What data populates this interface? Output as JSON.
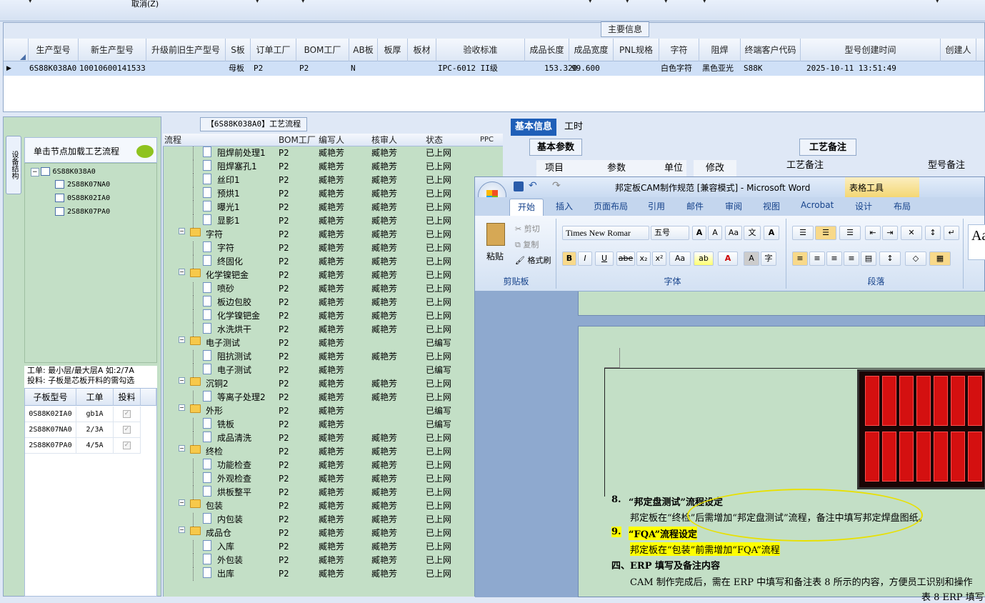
{
  "toolbar": {
    "cancel_label": "取消(Z)"
  },
  "main_info": {
    "title": "主要信息",
    "columns": [
      "生产型号",
      "新生产型号",
      "升级前旧生产型号",
      "S板",
      "订单工厂",
      "BOM工厂",
      "AB板",
      "板厚",
      "板材",
      "验收标准",
      "成品长度",
      "成品宽度",
      "PNL规格",
      "字符",
      "阻焊",
      "终端客户代码",
      "型号创建时间",
      "创建人"
    ],
    "row": {
      "model": "6S88K038A0",
      "new_model": "10010600141533",
      "s_board": "母板",
      "order_factory": "P2",
      "bom_factory": "P2",
      "ab_board": "N",
      "standard": "IPC-6012 II级",
      "length": "153.320",
      "width": "99.600",
      "char": "白色字符",
      "solder": "黑色亚光",
      "customer": "S88K",
      "created": "2025-10-11 13:51:49"
    }
  },
  "left_panel": {
    "side_tab": "设备结构",
    "load_title": "单击节点加载工艺流程",
    "tree": {
      "root": "6S88K038A0",
      "children": [
        "2S88K07NA0",
        "0S88K02IA0",
        "2S88K07PA0"
      ]
    },
    "note1": "工单: 最小层/最大层A 如:2/7A",
    "note2": "投料: 子板是芯板开料的需勾选",
    "sub_grid": {
      "headers": [
        "子板型号",
        "工单",
        "投料"
      ],
      "rows": [
        {
          "model": "0S88K02IA0",
          "order": "gb1A"
        },
        {
          "model": "2S88K07NA0",
          "order": "2/3A"
        },
        {
          "model": "2S88K07PA0",
          "order": "4/5A"
        }
      ]
    }
  },
  "process": {
    "title": "【6S88K038A0】工艺流程",
    "headers": [
      "流程",
      "BOM工厂",
      "编写人",
      "核审人",
      "状态",
      "PPC"
    ],
    "rows": [
      {
        "name": "阻焊前处理1",
        "bom": "P2",
        "writer": "臧艳芳",
        "auditor": "臧艳芳",
        "status": "已上网",
        "level": 2
      },
      {
        "name": "阻焊塞孔1",
        "bom": "P2",
        "writer": "臧艳芳",
        "auditor": "臧艳芳",
        "status": "已上网",
        "level": 2
      },
      {
        "name": "丝印1",
        "bom": "P2",
        "writer": "臧艳芳",
        "auditor": "臧艳芳",
        "status": "已上网",
        "level": 2
      },
      {
        "name": "预烘1",
        "bom": "P2",
        "writer": "臧艳芳",
        "auditor": "臧艳芳",
        "status": "已上网",
        "level": 2
      },
      {
        "name": "曝光1",
        "bom": "P2",
        "writer": "臧艳芳",
        "auditor": "臧艳芳",
        "status": "已上网",
        "level": 2
      },
      {
        "name": "显影1",
        "bom": "P2",
        "writer": "臧艳芳",
        "auditor": "臧艳芳",
        "status": "已上网",
        "level": 2
      },
      {
        "name": "字符",
        "bom": "P2",
        "writer": "臧艳芳",
        "auditor": "臧艳芳",
        "status": "已上网",
        "level": 1
      },
      {
        "name": "字符",
        "bom": "P2",
        "writer": "臧艳芳",
        "auditor": "臧艳芳",
        "status": "已上网",
        "level": 2
      },
      {
        "name": "终固化",
        "bom": "P2",
        "writer": "臧艳芳",
        "auditor": "臧艳芳",
        "status": "已上网",
        "level": 2
      },
      {
        "name": "化学镍钯金",
        "bom": "P2",
        "writer": "臧艳芳",
        "auditor": "臧艳芳",
        "status": "已上网",
        "level": 1
      },
      {
        "name": "喷砂",
        "bom": "P2",
        "writer": "臧艳芳",
        "auditor": "臧艳芳",
        "status": "已上网",
        "level": 2
      },
      {
        "name": "板边包胶",
        "bom": "P2",
        "writer": "臧艳芳",
        "auditor": "臧艳芳",
        "status": "已上网",
        "level": 2
      },
      {
        "name": "化学镍钯金",
        "bom": "P2",
        "writer": "臧艳芳",
        "auditor": "臧艳芳",
        "status": "已上网",
        "level": 2
      },
      {
        "name": "水洗烘干",
        "bom": "P2",
        "writer": "臧艳芳",
        "auditor": "臧艳芳",
        "status": "已上网",
        "level": 2
      },
      {
        "name": "电子测试",
        "bom": "P2",
        "writer": "臧艳芳",
        "auditor": "",
        "status": "已编写",
        "level": 1
      },
      {
        "name": "阻抗测试",
        "bom": "P2",
        "writer": "臧艳芳",
        "auditor": "臧艳芳",
        "status": "已上网",
        "level": 2
      },
      {
        "name": "电子测试",
        "bom": "P2",
        "writer": "臧艳芳",
        "auditor": "",
        "status": "已编写",
        "level": 2
      },
      {
        "name": "沉铜2",
        "bom": "P2",
        "writer": "臧艳芳",
        "auditor": "臧艳芳",
        "status": "已上网",
        "level": 1
      },
      {
        "name": "等离子处理2",
        "bom": "P2",
        "writer": "臧艳芳",
        "auditor": "臧艳芳",
        "status": "已上网",
        "level": 2
      },
      {
        "name": "外形",
        "bom": "P2",
        "writer": "臧艳芳",
        "auditor": "",
        "status": "已编写",
        "level": 1
      },
      {
        "name": "铣板",
        "bom": "P2",
        "writer": "臧艳芳",
        "auditor": "",
        "status": "已编写",
        "level": 2
      },
      {
        "name": "成品清洗",
        "bom": "P2",
        "writer": "臧艳芳",
        "auditor": "臧艳芳",
        "status": "已上网",
        "level": 2
      },
      {
        "name": "终检",
        "bom": "P2",
        "writer": "臧艳芳",
        "auditor": "臧艳芳",
        "status": "已上网",
        "level": 1
      },
      {
        "name": "功能检查",
        "bom": "P2",
        "writer": "臧艳芳",
        "auditor": "臧艳芳",
        "status": "已上网",
        "level": 2
      },
      {
        "name": "外观检查",
        "bom": "P2",
        "writer": "臧艳芳",
        "auditor": "臧艳芳",
        "status": "已上网",
        "level": 2
      },
      {
        "name": "烘板整平",
        "bom": "P2",
        "writer": "臧艳芳",
        "auditor": "臧艳芳",
        "status": "已上网",
        "level": 2
      },
      {
        "name": "包装",
        "bom": "P2",
        "writer": "臧艳芳",
        "auditor": "臧艳芳",
        "status": "已上网",
        "level": 1
      },
      {
        "name": "内包装",
        "bom": "P2",
        "writer": "臧艳芳",
        "auditor": "臧艳芳",
        "status": "已上网",
        "level": 2
      },
      {
        "name": "成品仓",
        "bom": "P2",
        "writer": "臧艳芳",
        "auditor": "臧艳芳",
        "status": "已上网",
        "level": 1
      },
      {
        "name": "入库",
        "bom": "P2",
        "writer": "臧艳芳",
        "auditor": "臧艳芳",
        "status": "已上网",
        "level": 2
      },
      {
        "name": "外包装",
        "bom": "P2",
        "writer": "臧艳芳",
        "auditor": "臧艳芳",
        "status": "已上网",
        "level": 2
      },
      {
        "name": "出库",
        "bom": "P2",
        "writer": "臧艳芳",
        "auditor": "臧艳芳",
        "status": "已上网",
        "level": 2
      }
    ]
  },
  "right_panel": {
    "tabs": [
      "基本信息",
      "工时"
    ],
    "sub_tab": "基本参数",
    "notes_tab": "工艺备注",
    "param_headers": [
      "项目",
      "参数",
      "单位",
      "修改"
    ],
    "notes_headers": [
      "工艺备注",
      "型号备注"
    ]
  },
  "word": {
    "title": "邦定板CAM制作规范 [兼容模式] - Microsoft Word",
    "context_tab": "表格工具",
    "tabs": [
      "开始",
      "插入",
      "页面布局",
      "引用",
      "邮件",
      "审阅",
      "视图",
      "Acrobat",
      "设计",
      "布局"
    ],
    "clipboard": {
      "paste": "粘贴",
      "cut": "剪切",
      "copy": "复制",
      "format_painter": "格式刷",
      "label": "剪贴板"
    },
    "font": {
      "name": "Times New Romar",
      "size": "五号",
      "label": "字体"
    },
    "paragraph_label": "段落",
    "style_preview": "Aa",
    "doc": {
      "item8_num": "8.",
      "item8_title": "“邦定盘测试”流程设定",
      "item8_body": "邦定板在“终检”后需增加“邦定盘测试”流程，备注中填写邦定焊盘图纸。",
      "item9_num": "9.",
      "item9_title": "“FQA”流程设定",
      "item9_body": "邦定板在“包装”前需增加“FQA”流程",
      "section4": "四、ERP 填写及备注内容",
      "section4_body": "CAM 制作完成后，需在 ERP 中填写和备注表 8 所示的内容，方便员工识别和操作",
      "table_caption": "表 8 ERP 填写"
    }
  },
  "colors": {
    "panel_green": "#c3dfc6",
    "highlight_yellow": "#ffff00",
    "selected_row": "#cfe0f7",
    "word_blue": "#15428b"
  }
}
